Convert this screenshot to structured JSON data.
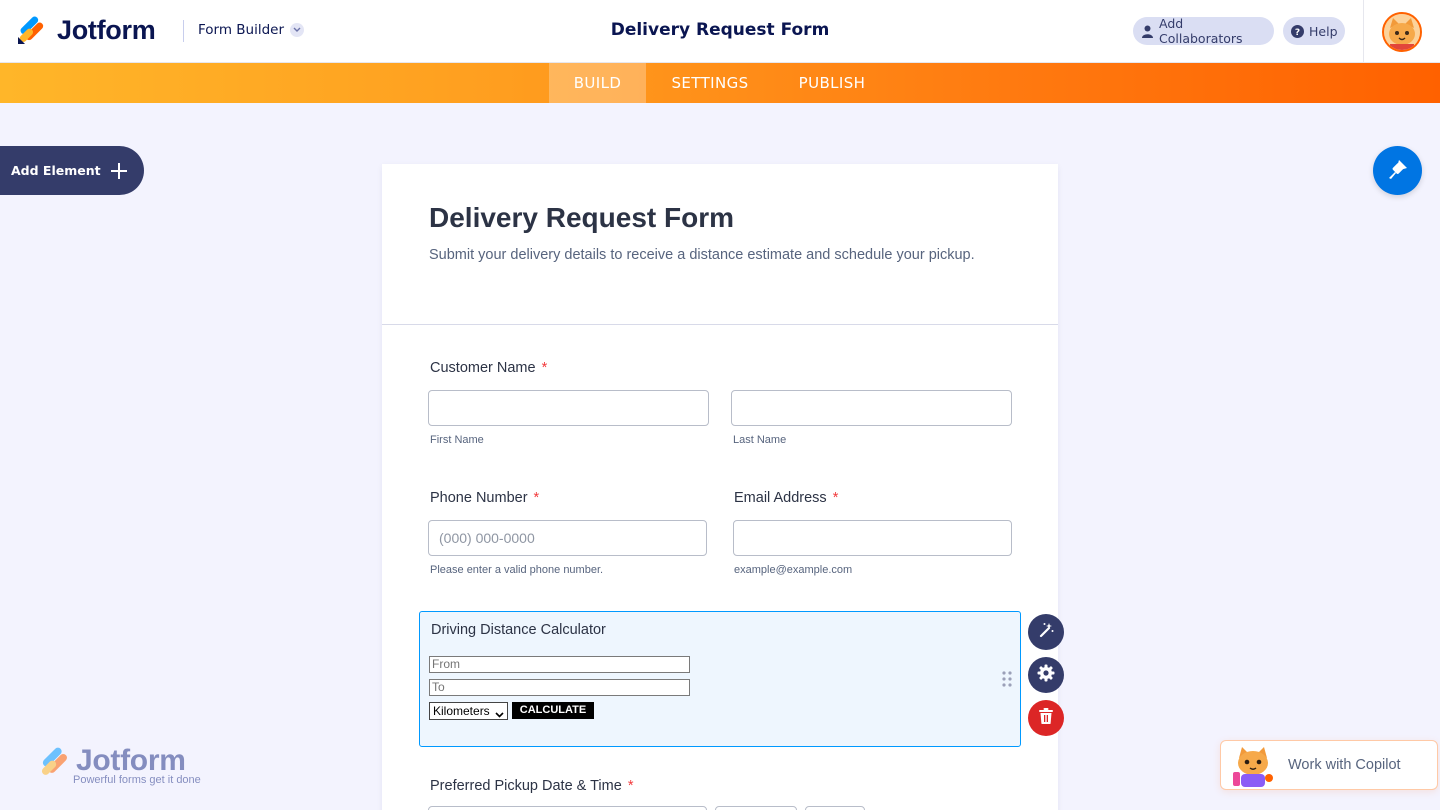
{
  "header": {
    "brand": "Jotform",
    "product": "Form Builder",
    "title": "Delivery Request Form",
    "collaborators_label": "Add Collaborators",
    "help_label": "Help"
  },
  "nav": {
    "tabs": [
      "BUILD",
      "SETTINGS",
      "PUBLISH"
    ],
    "active": "BUILD"
  },
  "sidebar": {
    "add_element_label": "Add Element"
  },
  "form": {
    "title": "Delivery Request Form",
    "subtitle": "Submit your delivery details to receive a distance estimate and schedule your pickup.",
    "customer_name": {
      "label": "Customer Name",
      "required_mark": "*",
      "first_sublabel": "First Name",
      "last_sublabel": "Last Name"
    },
    "phone": {
      "label": "Phone Number",
      "required_mark": "*",
      "placeholder": "(000) 000-0000",
      "sublabel": "Please enter a valid phone number."
    },
    "email": {
      "label": "Email Address",
      "required_mark": "*",
      "sublabel": "example@example.com"
    },
    "distance_widget": {
      "title": "Driving Distance Calculator",
      "from_placeholder": "From",
      "to_placeholder": "To",
      "unit_selected": "Kilometers",
      "calculate_label": "CALCULATE"
    },
    "pickup": {
      "label": "Preferred Pickup Date & Time",
      "required_mark": "*"
    }
  },
  "watermark": {
    "brand": "Jotform",
    "tagline": "Powerful forms get it done"
  },
  "copilot": {
    "label": "Work with Copilot"
  },
  "colors": {
    "accent_orange": "#ff6100",
    "nav_gradient_start": "#ffb629",
    "primary_blue": "#0075e3",
    "navy": "#343c6a",
    "danger": "#dc2626",
    "selected_border": "#0099ff"
  },
  "icons": [
    "jotform-logo-icon",
    "chevron-down-icon",
    "user-icon",
    "help-icon",
    "avatar",
    "plus-icon",
    "paint-brush-icon",
    "magic-wand-icon",
    "gear-icon",
    "trash-icon",
    "drag-handle-icon",
    "copilot-mascot-icon"
  ]
}
